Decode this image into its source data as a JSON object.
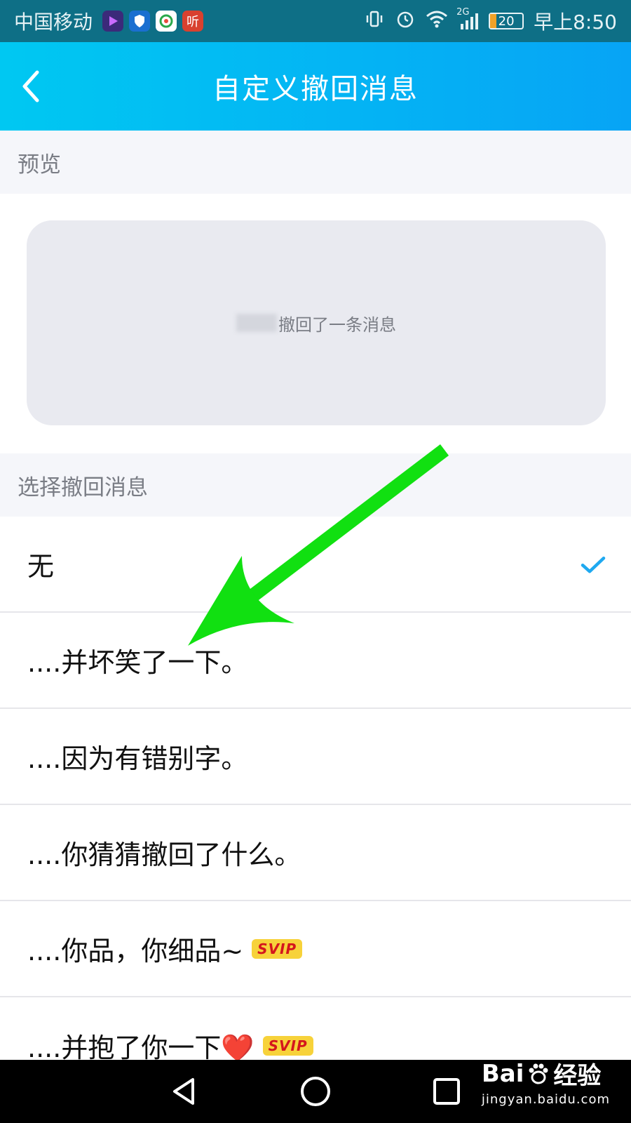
{
  "status_bar": {
    "carrier": "中国移动",
    "app_icon_ting": "听",
    "network": "2G",
    "battery_level": "20",
    "time": "早上8:50"
  },
  "header": {
    "title": "自定义撤回消息"
  },
  "preview_section": {
    "label": "预览",
    "message": "撤回了一条消息"
  },
  "select_section": {
    "label": "选择撤回消息"
  },
  "options": [
    {
      "label": "无",
      "selected": true
    },
    {
      "label": "....并坏笑了一下。"
    },
    {
      "label": "....因为有错别字。"
    },
    {
      "label": "....你猜猜撤回了什么。"
    },
    {
      "label": "....你品，你细品~",
      "badge": "SVIP"
    },
    {
      "label": "....并抱了你一下❤️",
      "badge": "SVIP"
    }
  ],
  "watermark": {
    "brand_a": "Bai",
    "brand_b": "经验",
    "url": "jingyan.baidu.com"
  },
  "colors": {
    "header_gradient_start": "#00c8f2",
    "header_gradient_end": "#07a4f5",
    "check_color": "#1fa9f0",
    "arrow_color": "#11e011",
    "svip_bg": "#f7d23a",
    "svip_text": "#d4161d"
  },
  "icons": {
    "back": "chevron-left-icon",
    "check": "check-icon",
    "nav_back": "triangle-back-icon",
    "nav_home": "circle-home-icon",
    "nav_recent": "square-recent-icon"
  }
}
